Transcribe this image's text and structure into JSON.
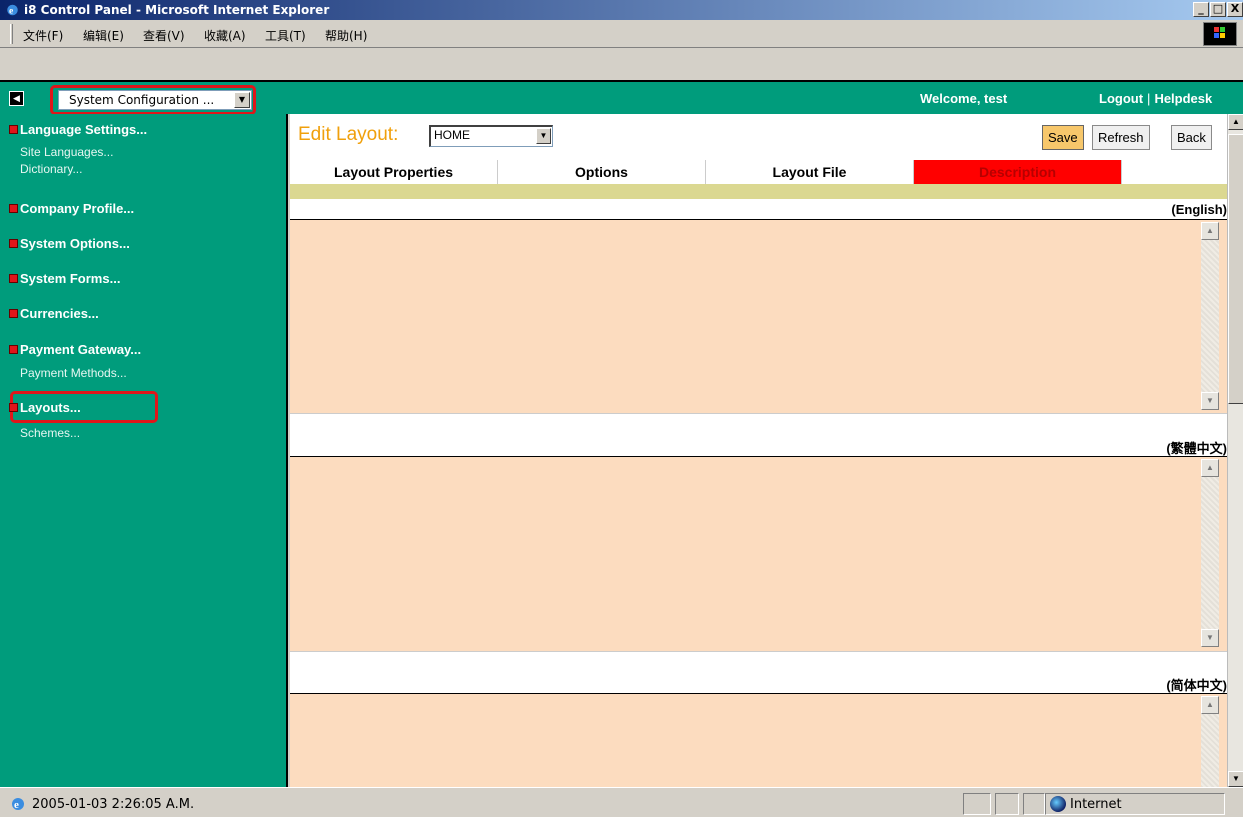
{
  "window": {
    "title": "i8 Control Panel - Microsoft Internet Explorer",
    "controls": {
      "minimize": "_",
      "maximize": "□",
      "close": "X"
    }
  },
  "menu": {
    "items": [
      "文件(F)",
      "编辑(E)",
      "查看(V)",
      "收藏(A)",
      "工具(T)",
      "帮助(H)"
    ]
  },
  "header": {
    "module_select": "System Configuration ...",
    "welcome": "Welcome, test",
    "logout": "Logout",
    "separator": "|",
    "helpdesk": "Helpdesk"
  },
  "sidebar": {
    "sections": [
      {
        "label": "Language Settings...",
        "subitems": [
          "Site Languages...",
          "Dictionary..."
        ]
      },
      {
        "label": "Company Profile...",
        "subitems": []
      },
      {
        "label": "System Options...",
        "subitems": []
      },
      {
        "label": "System Forms...",
        "subitems": []
      },
      {
        "label": "Currencies...",
        "subitems": []
      },
      {
        "label": "Payment Gateway...",
        "subitems": [
          "Payment Methods..."
        ]
      },
      {
        "label": "Layouts...",
        "subitems": [
          "Schemes..."
        ]
      }
    ]
  },
  "main": {
    "edit_label": "Edit Layout:",
    "layout_value": "HOME",
    "buttons": {
      "save": "Save",
      "refresh": "Refresh",
      "back": "Back"
    },
    "tabs": [
      "Layout Properties",
      "Options",
      "Layout File",
      "Description"
    ],
    "active_tab": "Description",
    "languages": [
      "(English)",
      "(繁體中文)",
      "(简体中文)"
    ]
  },
  "status": {
    "text": "2005-01-03 2:26:05 A.M.",
    "zone": "Internet"
  },
  "colors": {
    "app_green": "#009c7c",
    "highlight_red": "#e0161a",
    "textarea_bg": "#fcdcbf",
    "active_tab": "#ff0000",
    "edit_label": "#f0a00c"
  }
}
